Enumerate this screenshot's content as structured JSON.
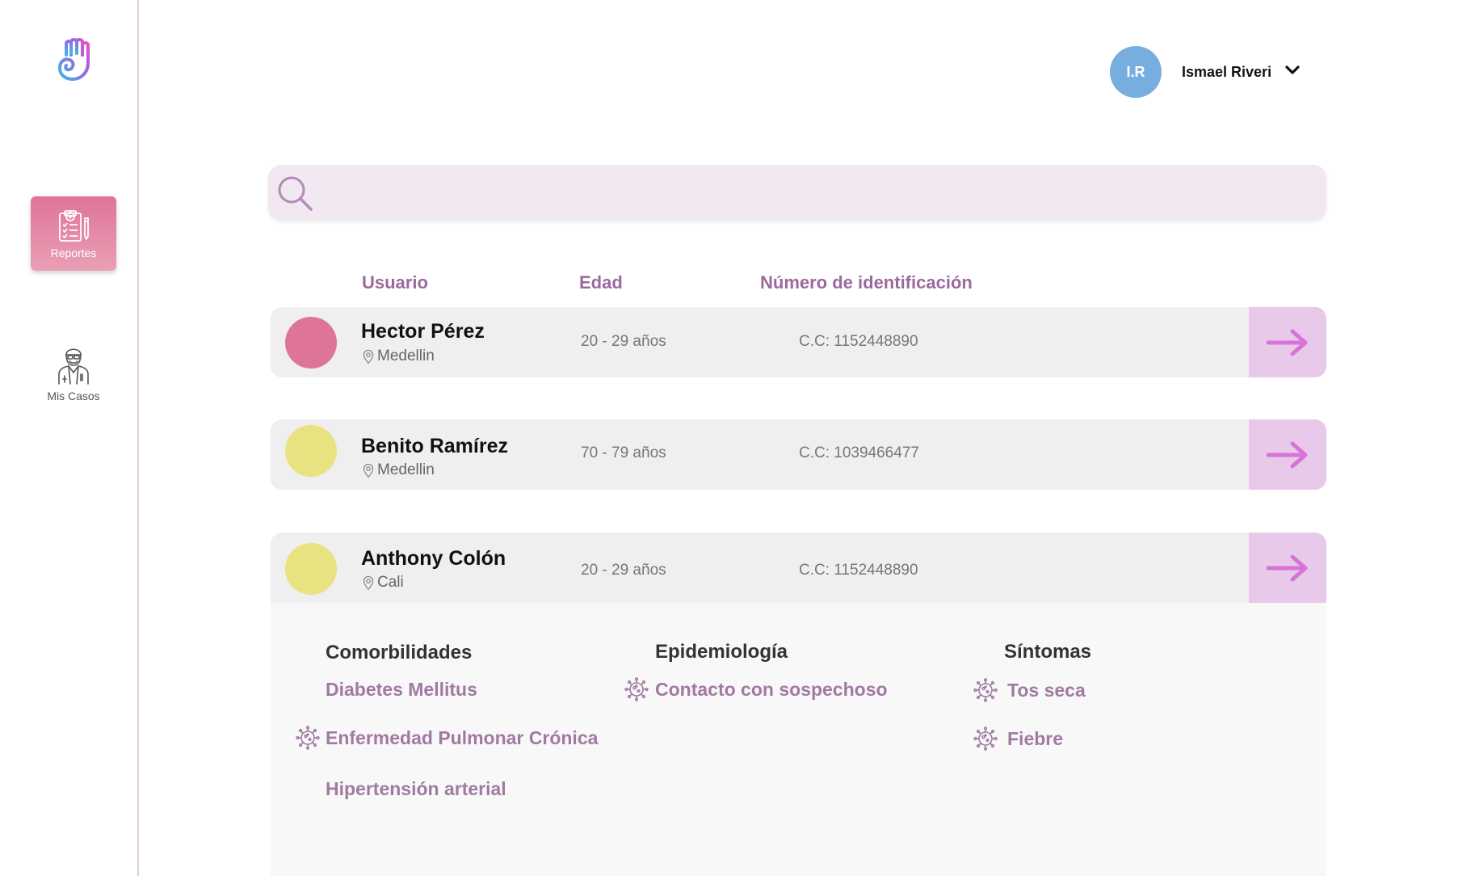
{
  "user": {
    "initials": "I.R",
    "name": "Ismael Riveri"
  },
  "nav": {
    "items": [
      {
        "label": "Reportes",
        "active": true
      },
      {
        "label": "Mis Casos",
        "active": false
      }
    ]
  },
  "table": {
    "headers": [
      "Usuario",
      "Edad",
      "Número de identificación"
    ]
  },
  "patients": [
    {
      "name": "Hector Pérez",
      "location": "Medellin",
      "age": "20 - 29 años",
      "id": "C.C: 1152448890",
      "status_color": "#de7597"
    },
    {
      "name": "Benito Ramírez",
      "location": "Medellin",
      "age": "70 - 79 años",
      "id": "C.C: 1039466477",
      "status_color": "#e8e280"
    },
    {
      "name": "Anthony Colón",
      "location": "Cali",
      "age": "20 - 29 años",
      "id": "C.C: 1152448890",
      "status_color": "#e8e280"
    }
  ],
  "details": {
    "comorbidities": {
      "title": "Comorbilidades",
      "items": [
        "Diabetes Mellitus",
        "Enfermedad Pulmonar Crónica",
        "Hipertensión arterial"
      ]
    },
    "epidemiology": {
      "title": "Epidemiología",
      "items": [
        "Contacto con sospechoso"
      ]
    },
    "symptoms": {
      "title": "Síntomas",
      "items": [
        "Tos seca",
        "Fiebre"
      ]
    }
  },
  "icons": {
    "logo": "hand-logo-icon",
    "reports": "clipboard-report-icon",
    "cases": "doctor-icon",
    "search": "search-icon",
    "dropdown": "chevron-down-icon",
    "row_action": "arrow-right-icon",
    "location": "map-pin-icon",
    "virus": "virus-icon"
  },
  "colors": {
    "accent_purple": "#9a6a9c",
    "arrow": "#d774d9",
    "reports_button": "#de7497",
    "avatar": "#78ade0",
    "search_bg": "#f1e8f1"
  }
}
